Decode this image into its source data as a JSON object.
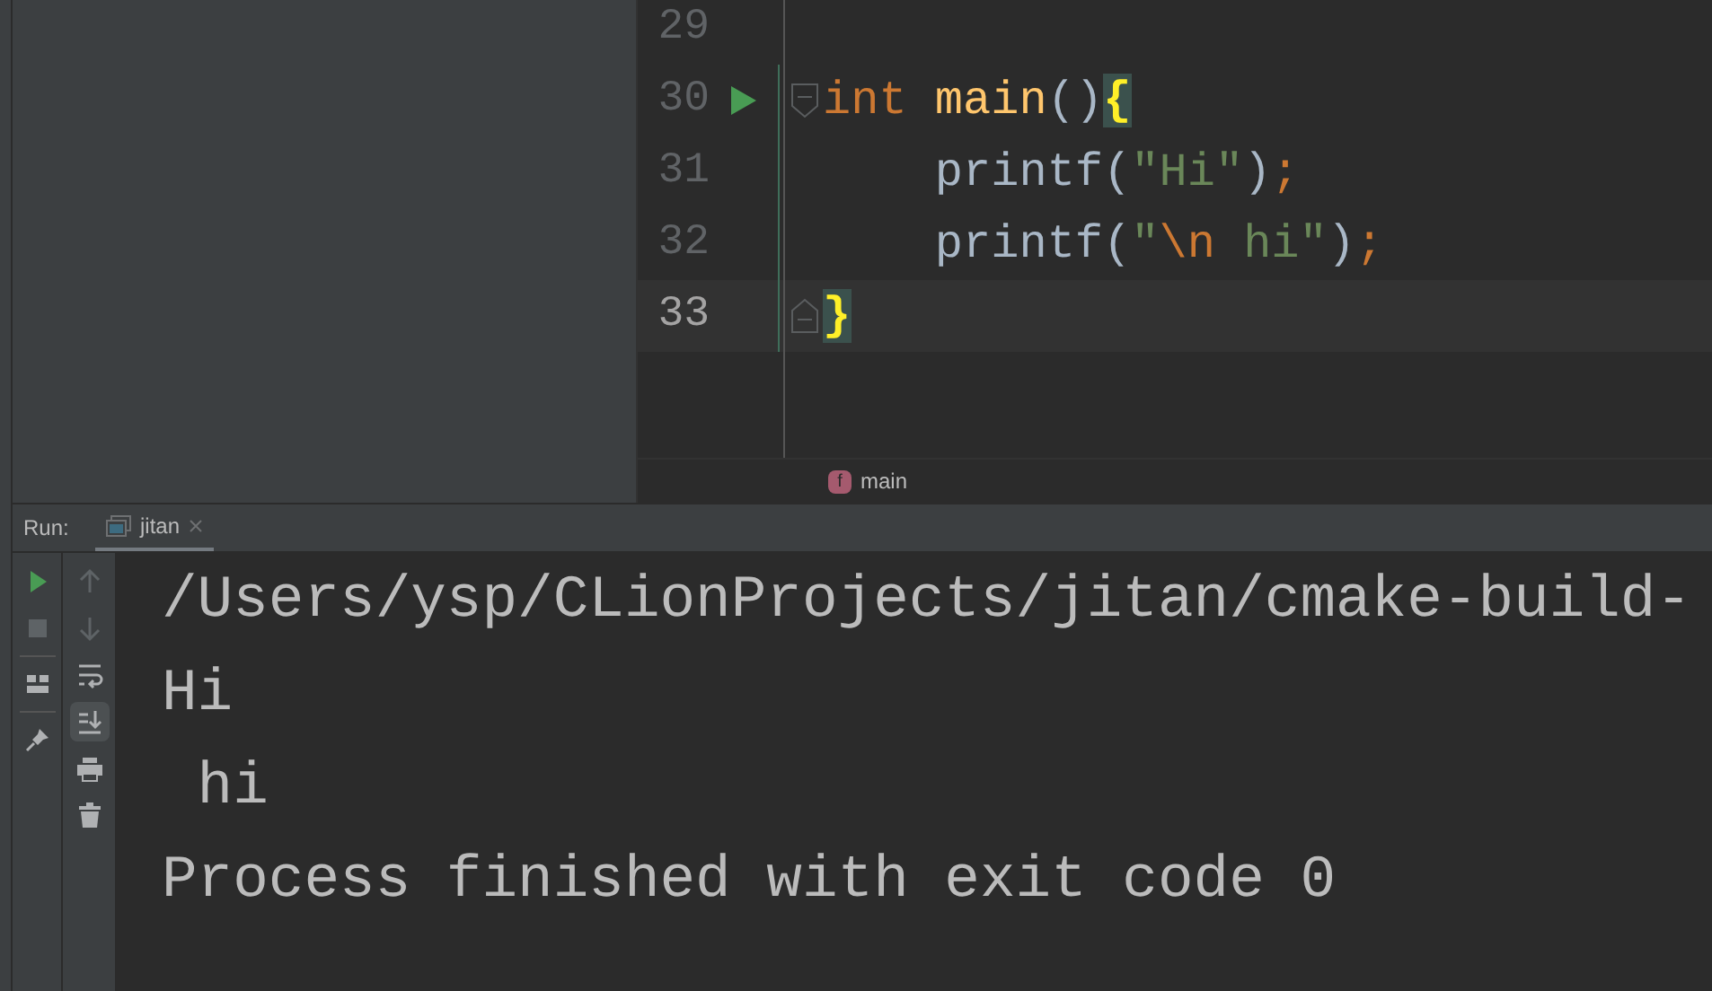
{
  "editor": {
    "lines": [
      {
        "number": "29",
        "current": false,
        "run_marker": false,
        "fold_start": false,
        "fold_end": false
      },
      {
        "number": "30",
        "current": false,
        "run_marker": true,
        "fold_start": true,
        "fold_end": false,
        "tokens": [
          {
            "kind": "keyword",
            "text": "int "
          },
          {
            "kind": "function",
            "text": "main"
          },
          {
            "kind": "punct",
            "text": "()"
          },
          {
            "kind": "brace_match",
            "text": "{"
          }
        ]
      },
      {
        "number": "31",
        "current": false,
        "run_marker": false,
        "fold_start": false,
        "fold_end": false,
        "tokens": [
          {
            "kind": "plain",
            "text": "    printf("
          },
          {
            "kind": "string",
            "text": "\"Hi\""
          },
          {
            "kind": "punct",
            "text": ")"
          },
          {
            "kind": "keyword",
            "text": ";"
          }
        ]
      },
      {
        "number": "32",
        "current": false,
        "run_marker": false,
        "fold_start": false,
        "fold_end": false,
        "tokens": [
          {
            "kind": "plain",
            "text": "    printf("
          },
          {
            "kind": "string",
            "text": "\""
          },
          {
            "kind": "escape",
            "text": "\\n"
          },
          {
            "kind": "string",
            "text": " hi\""
          },
          {
            "kind": "punct",
            "text": ")"
          },
          {
            "kind": "keyword",
            "text": ";"
          }
        ]
      },
      {
        "number": "33",
        "current": true,
        "run_marker": false,
        "fold_start": false,
        "fold_end": true,
        "tokens": [
          {
            "kind": "brace_match",
            "text": "}"
          }
        ]
      }
    ],
    "breadcrumb": {
      "badge": "f",
      "label": "main"
    }
  },
  "run": {
    "label": "Run:",
    "tabs": [
      {
        "label": "jitan",
        "selected": true
      }
    ],
    "toolbar_left": [
      {
        "kind": "play",
        "disabled": false,
        "selected": false
      },
      {
        "kind": "stop",
        "disabled": true,
        "selected": false
      },
      {
        "kind": "layout",
        "disabled": false,
        "selected": false
      },
      {
        "kind": "pin",
        "disabled": false,
        "selected": false
      }
    ],
    "toolbar_right": [
      {
        "kind": "up",
        "disabled": true,
        "selected": false
      },
      {
        "kind": "down",
        "disabled": true,
        "selected": false
      },
      {
        "kind": "wrap",
        "disabled": false,
        "selected": false
      },
      {
        "kind": "scroll_end",
        "disabled": false,
        "selected": true
      },
      {
        "kind": "print",
        "disabled": false,
        "selected": false
      },
      {
        "kind": "trash",
        "disabled": false,
        "selected": false
      }
    ],
    "console": [
      "/Users/ysp/CLionProjects/jitan/cmake-build-",
      "Hi",
      " hi",
      "Process finished with exit code 0"
    ]
  }
}
